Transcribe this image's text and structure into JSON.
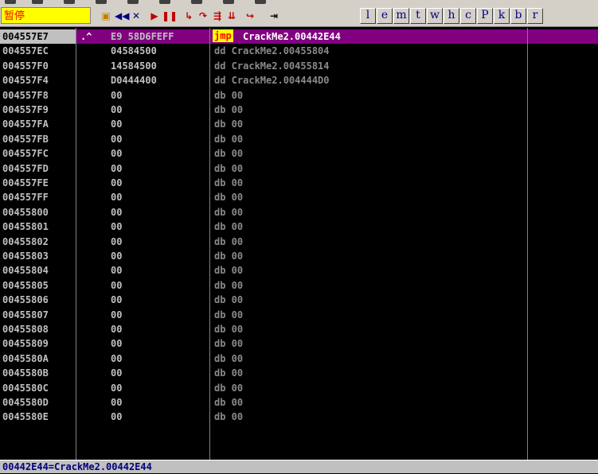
{
  "toolbar": {
    "status": "暂停",
    "letter_buttons": [
      "l",
      "e",
      "m",
      "t",
      "w",
      "h",
      "c",
      "P",
      "k",
      "b",
      "r"
    ],
    "icons": [
      "open-icon",
      "rewind-icon",
      "close-icon",
      "run-icon",
      "pause-icon",
      "step-into-icon",
      "step-over-icon",
      "trace-into-icon",
      "trace-over-icon",
      "execute-till-return-icon",
      "goto-icon"
    ]
  },
  "disassembly": {
    "selected_row": {
      "address": "004557E7",
      "marker": ".^",
      "hex": "E9 58D6FEFF",
      "mnemonic": "jmp",
      "operand": "CrackMe2.00442E44"
    },
    "rows": [
      {
        "address": "004557EC",
        "hex": "04584500",
        "text": "dd CrackMe2.00455804"
      },
      {
        "address": "004557F0",
        "hex": "14584500",
        "text": "dd CrackMe2.00455814"
      },
      {
        "address": "004557F4",
        "hex": "D0444400",
        "text": "dd CrackMe2.004444D0"
      },
      {
        "address": "004557F8",
        "hex": "00",
        "text": "db 00"
      },
      {
        "address": "004557F9",
        "hex": "00",
        "text": "db 00"
      },
      {
        "address": "004557FA",
        "hex": "00",
        "text": "db 00"
      },
      {
        "address": "004557FB",
        "hex": "00",
        "text": "db 00"
      },
      {
        "address": "004557FC",
        "hex": "00",
        "text": "db 00"
      },
      {
        "address": "004557FD",
        "hex": "00",
        "text": "db 00"
      },
      {
        "address": "004557FE",
        "hex": "00",
        "text": "db 00"
      },
      {
        "address": "004557FF",
        "hex": "00",
        "text": "db 00"
      },
      {
        "address": "00455800",
        "hex": "00",
        "text": "db 00"
      },
      {
        "address": "00455801",
        "hex": "00",
        "text": "db 00"
      },
      {
        "address": "00455802",
        "hex": "00",
        "text": "db 00"
      },
      {
        "address": "00455803",
        "hex": "00",
        "text": "db 00"
      },
      {
        "address": "00455804",
        "hex": "00",
        "text": "db 00"
      },
      {
        "address": "00455805",
        "hex": "00",
        "text": "db 00"
      },
      {
        "address": "00455806",
        "hex": "00",
        "text": "db 00"
      },
      {
        "address": "00455807",
        "hex": "00",
        "text": "db 00"
      },
      {
        "address": "00455808",
        "hex": "00",
        "text": "db 00"
      },
      {
        "address": "00455809",
        "hex": "00",
        "text": "db 00"
      },
      {
        "address": "0045580A",
        "hex": "00",
        "text": "db 00"
      },
      {
        "address": "0045580B",
        "hex": "00",
        "text": "db 00"
      },
      {
        "address": "0045580C",
        "hex": "00",
        "text": "db 00"
      },
      {
        "address": "0045580D",
        "hex": "00",
        "text": "db 00"
      },
      {
        "address": "0045580E",
        "hex": "00",
        "text": "db 00"
      }
    ]
  },
  "info_bar": "00442E44=CrackMe2.00442E44"
}
